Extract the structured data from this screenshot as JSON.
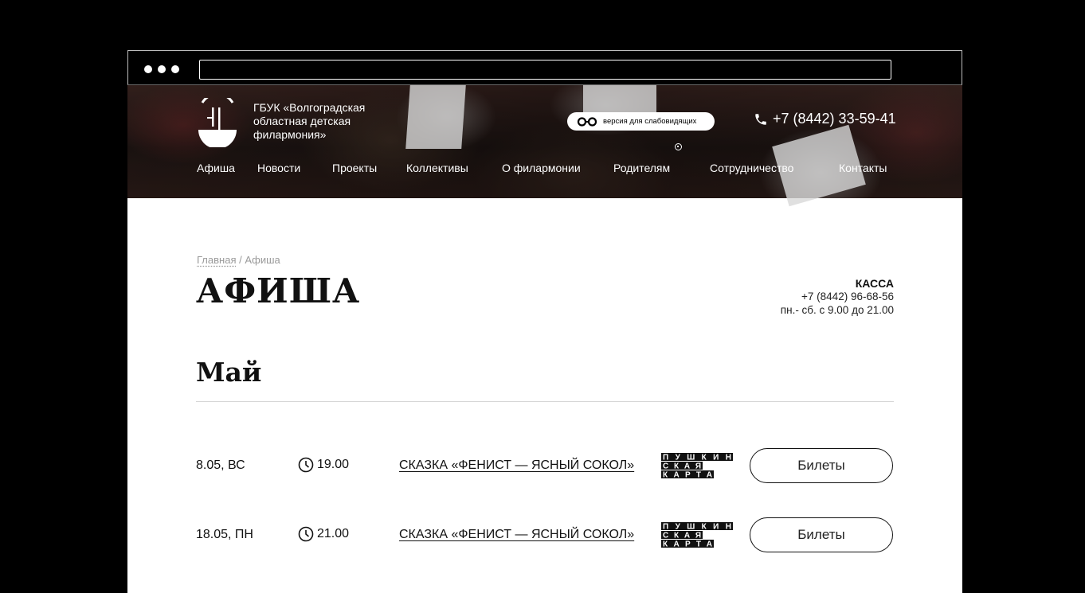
{
  "site": {
    "org_name": "ГБУК «Волгоградская областная детская филармония»",
    "vision_label": "версия для слабовидящих",
    "phone": "+7 (8442) 33-59-41"
  },
  "nav": {
    "items": [
      {
        "label": "Афиша"
      },
      {
        "label": "Новости"
      },
      {
        "label": "Проекты"
      },
      {
        "label": "Коллективы"
      },
      {
        "label": "О филармонии"
      },
      {
        "label": "Родителям"
      },
      {
        "label": "Сотрудничество"
      },
      {
        "label": "Контакты"
      }
    ]
  },
  "breadcrumb": {
    "home": "Главная",
    "separator": " / ",
    "current": "Афиша"
  },
  "page": {
    "title": "АФИША",
    "month": "Май"
  },
  "kassa": {
    "title": "КАССА",
    "phone": "+7 (8442) 96-68-56",
    "hours": "пн.- сб. с 9.00 до 21.00"
  },
  "events": [
    {
      "date": "8.05, ВС",
      "time": "19.00",
      "title": "СКАЗКА «ФЕНИСТ — ЯСНЫЙ СОКОЛ»",
      "badge": [
        "ПУШКИН",
        "СКАЯ",
        "КАРТА"
      ],
      "button": "Билеты"
    },
    {
      "date": "18.05, ПН",
      "time": "21.00",
      "title": "СКАЗКА «ФЕНИСТ — ЯСНЫЙ СОКОЛ»",
      "badge": [
        "ПУШКИН",
        "СКАЯ",
        "КАРТА"
      ],
      "button": "Билеты"
    }
  ],
  "icons": {
    "logo": "philharmonic-logo",
    "glasses": "glasses-icon",
    "phone": "phone-icon",
    "clock": "clock-icon"
  }
}
